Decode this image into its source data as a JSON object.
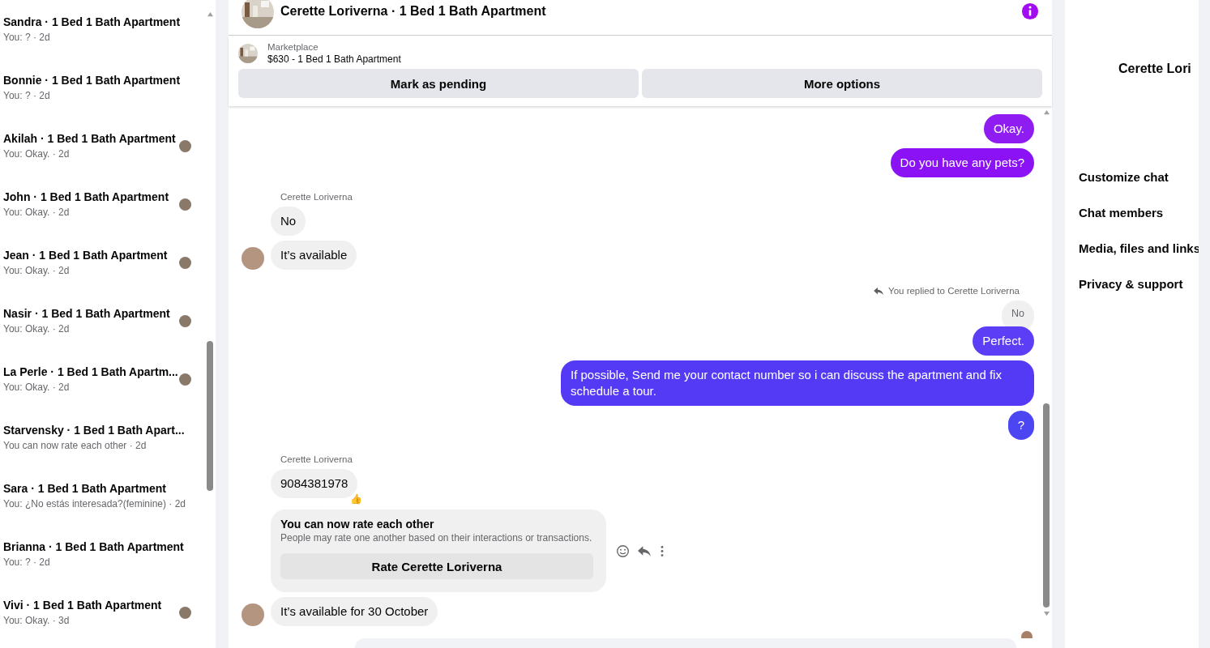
{
  "conversations": [
    {
      "title": "Sandra · 1 Bed 1 Bath Apartment",
      "preview": "You: ? · 2d",
      "seen_avatar": false
    },
    {
      "title": "Bonnie · 1 Bed 1 Bath Apartment",
      "preview": "You: ? · 2d",
      "seen_avatar": false
    },
    {
      "title": "Akilah · 1 Bed 1 Bath Apartment",
      "preview": "You: Okay. · 2d",
      "seen_avatar": true
    },
    {
      "title": "John · 1 Bed 1 Bath Apartment",
      "preview": "You: Okay. · 2d",
      "seen_avatar": true
    },
    {
      "title": "Jean · 1 Bed 1 Bath Apartment",
      "preview": "You: Okay. · 2d",
      "seen_avatar": true
    },
    {
      "title": "Nasir · 1 Bed 1 Bath Apartment",
      "preview": "You: Okay. · 2d",
      "seen_avatar": true
    },
    {
      "title": "La Perle · 1 Bed 1 Bath Apartm...",
      "preview": "You: Okay. · 2d",
      "seen_avatar": true
    },
    {
      "title": "Starvensky · 1 Bed 1 Bath Apart...",
      "preview": "You can now rate each other · 2d",
      "seen_avatar": false
    },
    {
      "title": "Sara · 1 Bed 1 Bath Apartment",
      "preview": "You: ¿No estás interesada?(feminine) · 2d",
      "seen_avatar": false
    },
    {
      "title": "Brianna · 1 Bed 1 Bath Apartment",
      "preview": "You: ? · 2d",
      "seen_avatar": false
    },
    {
      "title": "Vivi · 1 Bed 1 Bath Apartment",
      "preview": "You: Okay. · 3d",
      "seen_avatar": true
    }
  ],
  "chat": {
    "title": "Cerette Loriverna · 1 Bed 1 Bath Apartment",
    "listing": {
      "source": "Marketplace",
      "summary": "$630 - 1 Bed 1 Bath Apartment"
    },
    "actions": [
      "Mark as pending",
      "More options"
    ],
    "messages": [
      {
        "kind": "outgoing",
        "text": "Okay.",
        "color": "#8f1cf0"
      },
      {
        "kind": "outgoing",
        "text": "Do you have any pets?",
        "color": "#8a12f5"
      },
      {
        "kind": "sender",
        "text": "Cerette Loriverna"
      },
      {
        "kind": "incoming",
        "text": "No",
        "avatar": false
      },
      {
        "kind": "incoming",
        "text": "It’s available",
        "avatar": true
      },
      {
        "kind": "reply_note",
        "text": "You replied to Cerette Loriverna"
      },
      {
        "kind": "quote",
        "text": "No"
      },
      {
        "kind": "outgoing",
        "text": "Perfect.",
        "color": "#5b3ef5"
      },
      {
        "kind": "outgoing",
        "text": "If possible, Send me your contact number so i can discuss the apartment and fix schedule a tour.",
        "color": "#553af5"
      },
      {
        "kind": "outgoing",
        "text": "?",
        "color": "#4c45f2"
      },
      {
        "kind": "sender",
        "text": "Cerette Loriverna"
      },
      {
        "kind": "incoming",
        "text": "9084381978",
        "avatar": false,
        "reaction": "👍"
      },
      {
        "kind": "card",
        "title": "You can now rate each other",
        "body": "People may rate one another based on their interactions or transactions.",
        "button": "Rate Cerette Loriverna"
      },
      {
        "kind": "incoming",
        "text": "It’s available for 30 October",
        "avatar": true
      }
    ]
  },
  "details": {
    "name": "Cerette Lori",
    "items": [
      "Customize chat",
      "Chat members",
      "Media, files and links",
      "Privacy & support"
    ]
  }
}
